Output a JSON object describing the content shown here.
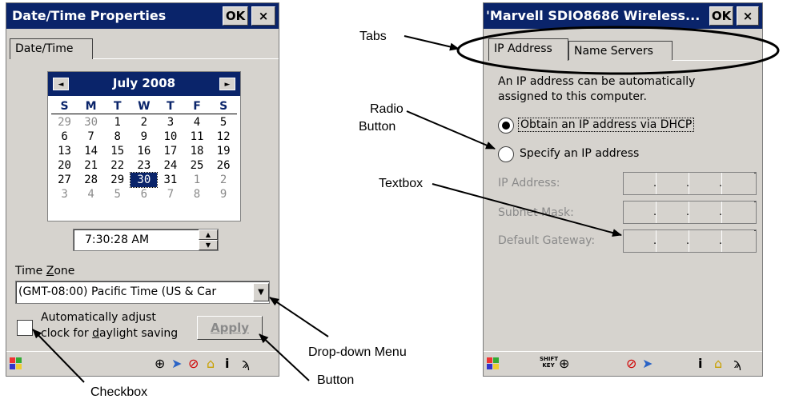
{
  "left": {
    "title": "Date/Time Properties",
    "ok": "OK",
    "close": "×",
    "tab": "Date/Time",
    "calendar": {
      "prev": "◄",
      "next": "►",
      "month": "July 2008",
      "dow": [
        "S",
        "M",
        "T",
        "W",
        "T",
        "F",
        "S"
      ],
      "weeks": [
        [
          {
            "d": "29",
            "m": true
          },
          {
            "d": "30",
            "m": true
          },
          {
            "d": "1"
          },
          {
            "d": "2"
          },
          {
            "d": "3"
          },
          {
            "d": "4"
          },
          {
            "d": "5"
          }
        ],
        [
          {
            "d": "6"
          },
          {
            "d": "7"
          },
          {
            "d": "8"
          },
          {
            "d": "9"
          },
          {
            "d": "10"
          },
          {
            "d": "11"
          },
          {
            "d": "12"
          }
        ],
        [
          {
            "d": "13"
          },
          {
            "d": "14"
          },
          {
            "d": "15"
          },
          {
            "d": "16"
          },
          {
            "d": "17"
          },
          {
            "d": "18"
          },
          {
            "d": "19"
          }
        ],
        [
          {
            "d": "20"
          },
          {
            "d": "21"
          },
          {
            "d": "22"
          },
          {
            "d": "23"
          },
          {
            "d": "24"
          },
          {
            "d": "25"
          },
          {
            "d": "26"
          }
        ],
        [
          {
            "d": "27"
          },
          {
            "d": "28"
          },
          {
            "d": "29"
          },
          {
            "d": "30",
            "s": true
          },
          {
            "d": "31"
          },
          {
            "d": "1",
            "m": true
          },
          {
            "d": "2",
            "m": true
          }
        ],
        [
          {
            "d": "3",
            "m": true
          },
          {
            "d": "4",
            "m": true
          },
          {
            "d": "5",
            "m": true
          },
          {
            "d": "6",
            "m": true
          },
          {
            "d": "7",
            "m": true
          },
          {
            "d": "8",
            "m": true
          },
          {
            "d": "9",
            "m": true
          }
        ]
      ]
    },
    "time": "7:30:28 AM",
    "timezone_label_pre": "Time ",
    "timezone_label_ul": "Z",
    "timezone_label_post": "one",
    "timezone_value": "(GMT-08:00) Pacific Time (US & Car",
    "checkbox_line1": "Automatically adjust",
    "checkbox_line2_pre": "clock for ",
    "checkbox_line2_ul": "d",
    "checkbox_line2_post": "aylight saving",
    "apply": "Apply"
  },
  "right": {
    "title": "'Marvell SDIO8686 Wireless...",
    "ok": "OK",
    "close": "×",
    "tabs": [
      "IP Address",
      "Name Servers"
    ],
    "desc_line1": "An IP address can be automatically",
    "desc_line2": "assigned to this computer.",
    "radio1": "Obtain an IP address via DHCP",
    "radio2": "Specify an IP address",
    "field_ip": "IP Address:",
    "field_subnet": "Subnet Mask:",
    "field_gateway": "Default Gateway:",
    "ip_dot": ".",
    "shift_key": "SHIFT KEY"
  },
  "annotations": {
    "tabs": "Tabs",
    "radio_line1": "Radio",
    "radio_line2": "Button",
    "textbox": "Textbox",
    "dropdown": "Drop-down Menu",
    "button": "Button",
    "checkbox": "Checkbox"
  },
  "colors": {
    "title_bar": "#0a246a",
    "window_face": "#d6d3ce",
    "disabled_text": "#8a8a8a"
  }
}
